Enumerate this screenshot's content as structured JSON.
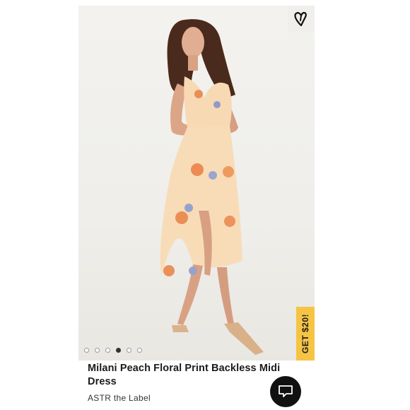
{
  "product": {
    "title": "Milani Peach Floral Print Backless Midi Dress",
    "brand": "ASTR the Label"
  },
  "carousel": {
    "count": 6,
    "active_index": 3
  },
  "promo": {
    "label": "GET $20!",
    "color": "#f6c445"
  },
  "icons": {
    "favorite": "heart-outline-icon",
    "chat": "chat-bubble-icon"
  }
}
